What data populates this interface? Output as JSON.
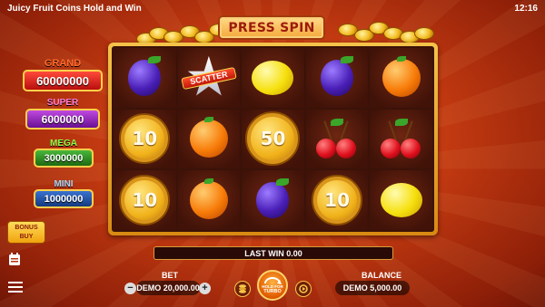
{
  "status": {
    "game_title": "Juicy Fruit Coins Hold and Win",
    "time": "12:16"
  },
  "banner": {
    "label": "PRESS SPIN"
  },
  "jackpots": [
    {
      "label": "GRAND",
      "value": "60000000",
      "label_color": "#ff6b2b",
      "box_color": "#d81e1e"
    },
    {
      "label": "SUPER",
      "value": "6000000",
      "label_color": "#ff7fd8",
      "box_color": "#8a1fb0"
    },
    {
      "label": "MEGA",
      "value": "3000000",
      "label_color": "#8aff4a",
      "box_color": "#2f8d22"
    },
    {
      "label": "MINI",
      "value": "1000000",
      "label_color": "#9fd8ff",
      "box_color": "#1f4c9a"
    }
  ],
  "reels": {
    "rows": [
      [
        {
          "type": "plum"
        },
        {
          "type": "scatter",
          "label": "SCATTER"
        },
        {
          "type": "lemon"
        },
        {
          "type": "plum"
        },
        {
          "type": "orange"
        }
      ],
      [
        {
          "type": "coin",
          "value": "10"
        },
        {
          "type": "orange"
        },
        {
          "type": "coin",
          "value": "50"
        },
        {
          "type": "cherry"
        },
        {
          "type": "cherry"
        }
      ],
      [
        {
          "type": "coin",
          "value": "10"
        },
        {
          "type": "orange"
        },
        {
          "type": "plum"
        },
        {
          "type": "coin",
          "value": "10"
        },
        {
          "type": "lemon"
        }
      ]
    ]
  },
  "last_win": {
    "text": "LAST WIN 0.00"
  },
  "bet": {
    "label": "BET",
    "value": "DEMO 20,000.00",
    "minus": "−",
    "plus": "+"
  },
  "balance": {
    "label": "BALANCE",
    "value": "DEMO 5,000.00"
  },
  "spin": {
    "label_line1": "HOLD FOR",
    "label_line2": "TURBO"
  },
  "bonus_buy": {
    "line1": "BONUS",
    "line2": "BUY"
  },
  "colors": {
    "frame": "#e8a72a",
    "banner_text": "#9d1a0c",
    "background": "#c93d12"
  }
}
